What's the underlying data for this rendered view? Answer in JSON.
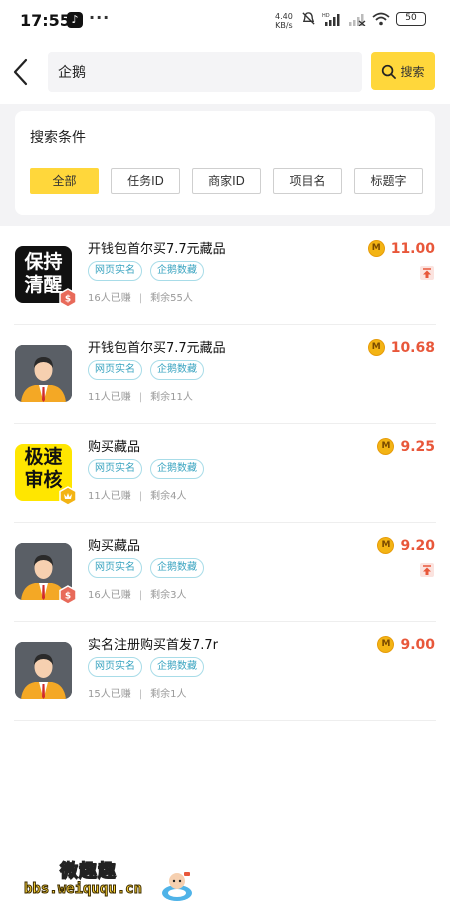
{
  "status_bar": {
    "time": "17:55",
    "more": "···",
    "net_speed_value": "4.40",
    "net_speed_unit": "KB/s",
    "battery": "50",
    "icons": [
      "tiktok-icon",
      "mute-icon",
      "hd-icon",
      "signal-icon",
      "signal-off-icon",
      "wifi-icon",
      "battery-icon"
    ]
  },
  "search": {
    "query": "企鹅",
    "button_label": "搜索"
  },
  "filter": {
    "title": "搜索条件",
    "chips": [
      "全部",
      "任务ID",
      "商家ID",
      "项目名",
      "标题字"
    ],
    "active_index": 0
  },
  "tasks": [
    {
      "thumb_text": [
        "保持",
        "清醒"
      ],
      "title": "开钱包首尔买7.7元藏品",
      "tags": [
        "网页实名",
        "企鹅数藏"
      ],
      "earned": "16人已赚",
      "remaining": "剩余55人",
      "reward": "11.00",
      "pinned": true,
      "badge": "red"
    },
    {
      "title": "开钱包首尔买7.7元藏品",
      "tags": [
        "网页实名",
        "企鹅数藏"
      ],
      "earned": "11人已赚",
      "remaining": "剩余11人",
      "reward": "10.68",
      "pinned": false,
      "badge": "none"
    },
    {
      "thumb_text": [
        "极速",
        "审核"
      ],
      "title": "购买藏品",
      "tags": [
        "网页实名",
        "企鹅数藏"
      ],
      "earned": "11人已赚",
      "remaining": "剩余4人",
      "reward": "9.25",
      "pinned": false,
      "badge": "gold"
    },
    {
      "title": "购买藏品",
      "tags": [
        "网页实名",
        "企鹅数藏"
      ],
      "earned": "16人已赚",
      "remaining": "剩余3人",
      "reward": "9.20",
      "pinned": true,
      "badge": "red"
    },
    {
      "title": "实名注册购买首发7.7r",
      "tags": [
        "网页实名",
        "企鹅数藏"
      ],
      "earned": "15人已赚",
      "remaining": "剩余1人",
      "reward": "9.00",
      "pinned": false,
      "badge": "none"
    }
  ],
  "coin_glyph": "M",
  "meta_separator": "|",
  "watermark": {
    "name": "微趣趣",
    "url": "bbs.weiququ.cn"
  },
  "colors": {
    "accent": "#ffd73b",
    "reward": "#e8573a",
    "tag": "#3aa4c0",
    "coin": "#f3b414"
  }
}
